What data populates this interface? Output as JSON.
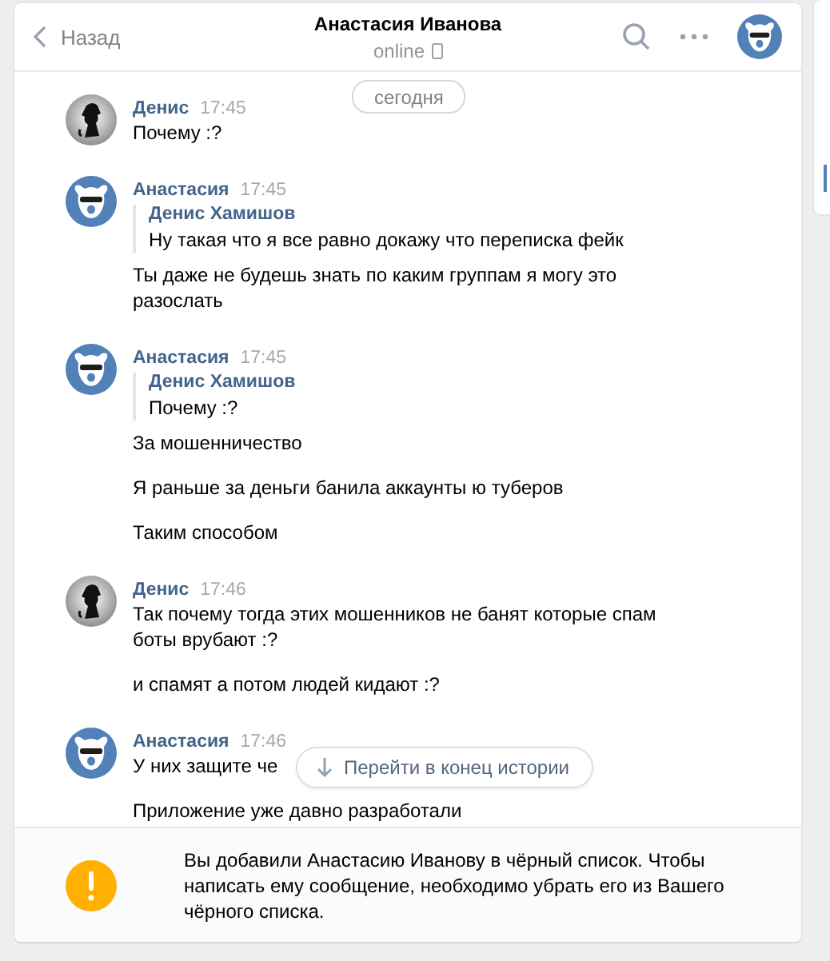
{
  "header": {
    "back": "Назад",
    "title": "Анастасия Иванова",
    "status": "online"
  },
  "date_pill": "сегодня",
  "messages": [
    {
      "author": "Денис",
      "kind": "silhouette",
      "time": "17:45",
      "items": [
        {
          "kind": "text",
          "text": "Почему :?"
        }
      ]
    },
    {
      "author": "Анастасия",
      "kind": "bear",
      "time": "17:45",
      "items": [
        {
          "kind": "quote",
          "author": "Денис Хамишов",
          "text": "Ну такая что я все равно докажу что переписка фейк"
        },
        {
          "kind": "text",
          "text": "Ты даже не будешь знать по каким группам я могу это разослать"
        }
      ]
    },
    {
      "author": "Анастасия",
      "kind": "bear",
      "time": "17:45",
      "items": [
        {
          "kind": "quote",
          "author": "Денис Хамишов",
          "text": "Почему :?"
        },
        {
          "kind": "text",
          "text": "За мошенничество"
        },
        {
          "kind": "text",
          "text": "Я раньше за деньги банила аккаунты ю туберов"
        },
        {
          "kind": "text",
          "text": "Таким способом"
        }
      ]
    },
    {
      "author": "Денис",
      "kind": "silhouette",
      "time": "17:46",
      "items": [
        {
          "kind": "text",
          "text": "Так почему тогда этих мошенников не банят которые спам боты врубают :?"
        },
        {
          "kind": "text",
          "text": "и спамят а потом людей кидают :?"
        }
      ]
    },
    {
      "author": "Анастасия",
      "kind": "bear",
      "time": "17:46",
      "items": [
        {
          "kind": "text",
          "text": "У них защите че"
        },
        {
          "kind": "text",
          "text": "Приложение уже давно разработали"
        }
      ]
    }
  ],
  "jump_button": "Перейти в конец истории",
  "notice": "Вы добавили Анастасию Иванову в чёрный список. Чтобы написать ему сообщение, необходимо убрать его из Вашего чёрного списка."
}
